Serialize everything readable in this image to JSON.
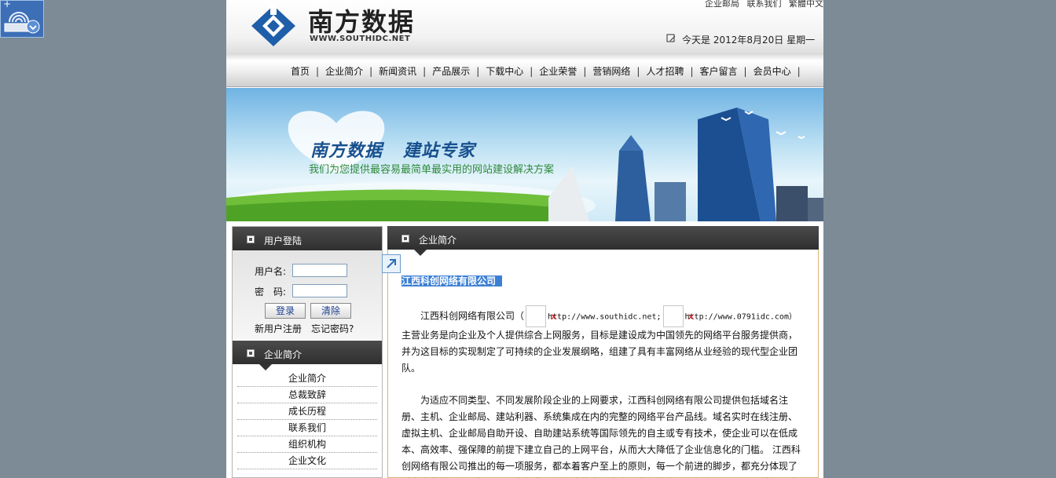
{
  "header": {
    "logo_cn": "南方数据",
    "logo_en": "WWW.SOUTHIDC.NET",
    "top_links": [
      "企业邮局",
      "联系我们",
      "繁體中文"
    ],
    "date_text": "今天是  2012年8月20日  星期一"
  },
  "nav": {
    "items": [
      "首页",
      "企业简介",
      "新闻资讯",
      "产品展示",
      "下载中心",
      "企业荣誉",
      "营销网络",
      "人才招聘",
      "客户留言",
      "会员中心"
    ]
  },
  "banner": {
    "slogan_left": "南方数据",
    "slogan_right": "建站专家",
    "tagline": "我们为您提供最容易最简单最实用的网站建设解决方案"
  },
  "login": {
    "title": "用户登陆",
    "username_label": "用户名:",
    "password_label": "密　码:",
    "login_button": "登录",
    "clear_button": "清除",
    "register_link": "新用户注册",
    "forgot_link": "忘记密码?"
  },
  "sidebar": {
    "title": "企业简介",
    "items": [
      "企业简介",
      "总裁致辞",
      "成长历程",
      "联系我们",
      "组织机构",
      "企业文化"
    ]
  },
  "main": {
    "title": "企业简介",
    "company_heading": "江西科创网络有限公司",
    "intro_prefix": "江西科创网络有限公司（",
    "url1": "http://www.southidc.net;",
    "url2": "http://www.0791idc.com）",
    "para1_rest": "主营业务是向企业及个人提供综合上网服务，目标是建设成为中国领先的网络平台服务提供商，并为这目标的实现制定了可持续的企业发展纲略，组建了具有丰富网络从业经验的现代型企业团队。",
    "para2": "为适应不同类型、不同发展阶段企业的上网要求，江西科创网络有限公司提供包括域名注册、主机、企业邮局、建站利器、系统集成在内的完整的网络平台产品线。域名实时在线注册、虚拟主机、企业邮局自助开设、自助建站系统等国际领先的自主或专有技术，使企业可以在低成本、高效率、强保障的前提下建立自己的上网平台，从而大大降低了企业信息化的门槛。 江西科创网络有限公司推出的每一项服务，都本着客户至上的原则，每一个前进的脚步，都充分体现了对客户的尊重与关怀。正因为如此，我们才能赢得客户，赢得将来。在新世纪里，江西科创网络"
  },
  "colors": {
    "nav_bar": "#e6e6e6",
    "panel_head": "#3a3a3a",
    "heading_highlight": "#3b7fd4",
    "desktop": "#7c8b95"
  }
}
